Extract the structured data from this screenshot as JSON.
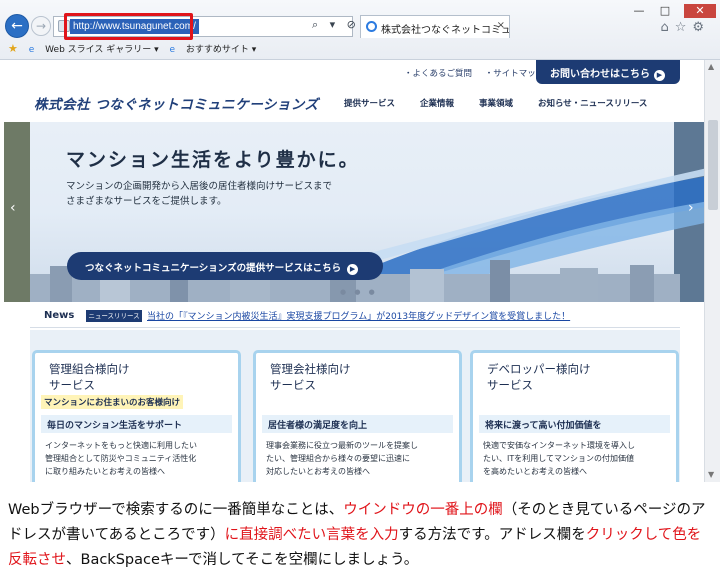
{
  "browser": {
    "address_url": "http://www.tsunagunet.com/",
    "address_tools": "⌕ ▾ ⊘ C",
    "tab_title": "株式会社つなぐネットコミュニケ...",
    "tab_close": "×",
    "favorites": [
      "Web スライス ギャラリー ▾",
      "おすすめサイト ▾"
    ],
    "window_buttons": [
      "—",
      "□",
      "✕"
    ],
    "right_icons": "⌂☆⚙",
    "back_glyph": "←",
    "forward_glyph": "→"
  },
  "site": {
    "util_links": [
      "・よくあるご質問",
      "・サイトマップ"
    ],
    "contact_button": "お問い合わせはこちら",
    "logo": "株式会社 つなぐネットコミュニケーションズ",
    "nav": [
      "提供サービス",
      "企業情報",
      "事業領域",
      "お知らせ・ニュースリリース"
    ],
    "hero": {
      "title": "マンション生活をより豊かに。",
      "subtitle_lines": [
        "マンションの企画開発から入居後の居住者様向けサービスまで",
        "さまざまなサービスをご提供します。"
      ],
      "button": "つなぐネットコミュニケーションズの提供サービスはこちら",
      "dots": "● ● ●"
    },
    "news": {
      "label": "News",
      "badge": "ニュースリリース",
      "text": "当社の「『マンション内被災生活』実現支援プログラム」が2013年度グッドデザイン賞を受賞しました！"
    },
    "cards": [
      {
        "title_lines": [
          "管理組合様向け",
          "サービス"
        ],
        "tag": "マンションにお住まいのお客様向け",
        "head": "毎日のマンション生活をサポート",
        "body": [
          "インターネットをもっと快適に利用したい",
          "管理組合として防災やコミュニティ活性化",
          "に取り組みたいとお考えの皆様へ"
        ]
      },
      {
        "title_lines": [
          "管理会社様向け",
          "サービス"
        ],
        "tag": "",
        "head": "居住者様の満足度を向上",
        "body": [
          "理事会業務に役立つ最新のツールを提案し",
          "たい、管理組合から様々の要望に迅速に",
          "対応したいとお考えの皆様へ"
        ]
      },
      {
        "title_lines": [
          "デベロッパー様向け",
          "サービス"
        ],
        "tag": "",
        "head": "将来に渡って高い付加価値を",
        "body": [
          "快適で安価なインターネット環境を導入し",
          "たい、ITを利用してマンションの付加価値",
          "を高めたいとお考えの皆様へ"
        ]
      }
    ]
  },
  "caption": {
    "p1": "Webブラウザーで検索するのに一番簡単なことは、",
    "r1": "ウインドウの一番上の欄",
    "p2": "（そのとき見ているページのアドレスが書いてあるところです）",
    "r2": "に直接調べたい言葉を入力",
    "p3": "する方法です。アドレス欄を",
    "r3": "クリックして色を反転させ",
    "p4": "、BackSpaceキーで消してそこを空欄にしましょう。"
  },
  "colors": {
    "accent_red": "#e0141a",
    "brand_navy": "#1d3b73",
    "card_border": "#a8d3ee"
  }
}
